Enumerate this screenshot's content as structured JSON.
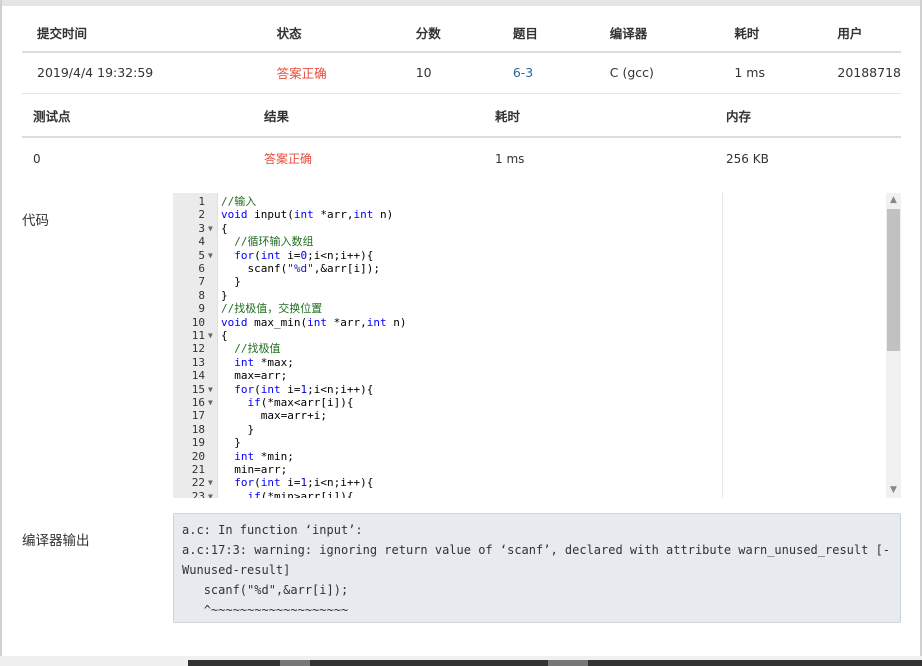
{
  "submission_table": {
    "headers": [
      "提交时间",
      "状态",
      "分数",
      "题目",
      "编译器",
      "耗时",
      "用户"
    ],
    "row": {
      "submit_time": "2019/4/4 19:32:59",
      "status": "答案正确",
      "score": "10",
      "problem": "6-3",
      "compiler": "C (gcc)",
      "time": "1 ms",
      "user": "20188718"
    }
  },
  "testcase_table": {
    "headers": [
      "测试点",
      "结果",
      "耗时",
      "内存"
    ],
    "rows": [
      {
        "id": "0",
        "result": "答案正确",
        "time": "1 ms",
        "memory": "256 KB"
      }
    ]
  },
  "labels": {
    "code": "代码",
    "compiler_output": "编译器输出"
  },
  "code_lines": [
    {
      "n": "1",
      "text": "//输入"
    },
    {
      "n": "2",
      "text": "void input(int *arr,int n)"
    },
    {
      "n": "3",
      "text": "{"
    },
    {
      "n": "4",
      "text": "  //循环输入数组"
    },
    {
      "n": "5",
      "text": "  for(int i=0;i<n;i++){"
    },
    {
      "n": "6",
      "text": "    scanf(\"%d\",&arr[i]);"
    },
    {
      "n": "7",
      "text": "  }"
    },
    {
      "n": "8",
      "text": "}"
    },
    {
      "n": "9",
      "text": "//找极值，交换位置"
    },
    {
      "n": "10",
      "text": "void max_min(int *arr,int n)"
    },
    {
      "n": "11",
      "text": "{"
    },
    {
      "n": "12",
      "text": "  //找极值"
    },
    {
      "n": "13",
      "text": "  int *max;"
    },
    {
      "n": "14",
      "text": "  max=arr;"
    },
    {
      "n": "15",
      "text": "  for(int i=1;i<n;i++){"
    },
    {
      "n": "16",
      "text": "    if(*max<arr[i]){"
    },
    {
      "n": "17",
      "text": "      max=arr+i;"
    },
    {
      "n": "18",
      "text": "    }"
    },
    {
      "n": "19",
      "text": "  }"
    },
    {
      "n": "20",
      "text": "  int *min;"
    },
    {
      "n": "21",
      "text": "  min=arr;"
    },
    {
      "n": "22",
      "text": "  for(int i=1;i<n;i++){"
    },
    {
      "n": "23",
      "text": "    if(*min>arr[i]){"
    }
  ],
  "fold_lines": [
    "3",
    "5",
    "11",
    "15",
    "16",
    "22",
    "23"
  ],
  "compiler_output": [
    "a.c: In function ‘input’:",
    "a.c:17:3: warning: ignoring return value of ‘scanf’, declared with attribute warn_unused_result [-Wunused-result]",
    "   scanf(\"%d\",&arr[i]);",
    "   ^~~~~~~~~~~~~~~~~~~~"
  ],
  "colors": {
    "status_ok": "#e74c3c",
    "link": "#2a6496",
    "keyword": "#0000ff",
    "comment": "#236e24",
    "output_bg": "#e7eaee"
  }
}
